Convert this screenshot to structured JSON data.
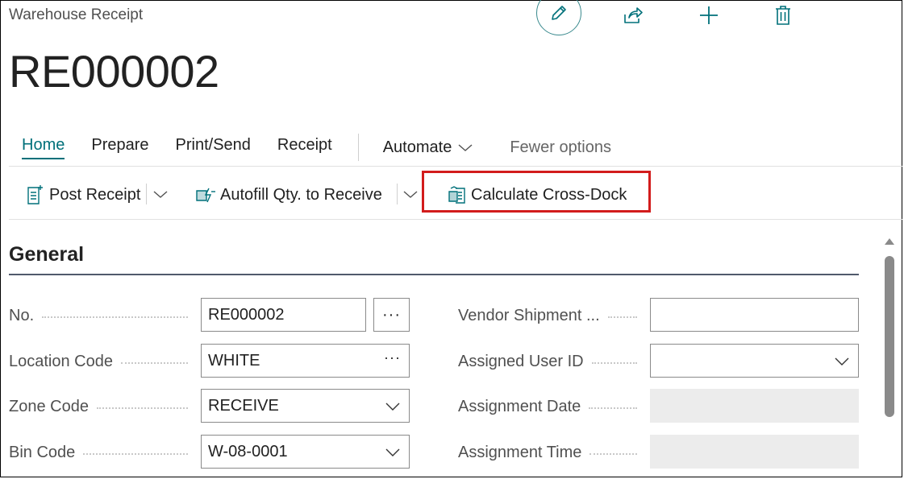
{
  "header": {
    "doc_type": "Warehouse Receipt",
    "title": "RE000002"
  },
  "top_actions": {
    "edit_icon": "pencil-icon",
    "share_icon": "share-icon",
    "new_icon": "plus-icon",
    "delete_icon": "trash-icon"
  },
  "nav": {
    "tabs": [
      "Home",
      "Prepare",
      "Print/Send",
      "Receipt"
    ],
    "automate": "Automate",
    "fewer_options": "Fewer options"
  },
  "toolbar": {
    "post_receipt": "Post Receipt",
    "autofill": "Autofill Qty. to Receive",
    "calculate_cross_dock": "Calculate Cross-Dock"
  },
  "general": {
    "title": "General",
    "left_fields": [
      {
        "label": "No.",
        "value": "RE000002"
      },
      {
        "label": "Location Code",
        "value": "WHITE"
      },
      {
        "label": "Zone Code",
        "value": "RECEIVE"
      },
      {
        "label": "Bin Code",
        "value": "W-08-0001"
      }
    ],
    "right_fields": [
      {
        "label": "Vendor Shipment ...",
        "value": ""
      },
      {
        "label": "Assigned User ID",
        "value": ""
      },
      {
        "label": "Assignment Date",
        "value": ""
      },
      {
        "label": "Assignment Time",
        "value": ""
      }
    ],
    "ellipsis": "···"
  },
  "colors": {
    "accent": "#00707a",
    "highlight": "#d21c1c"
  }
}
